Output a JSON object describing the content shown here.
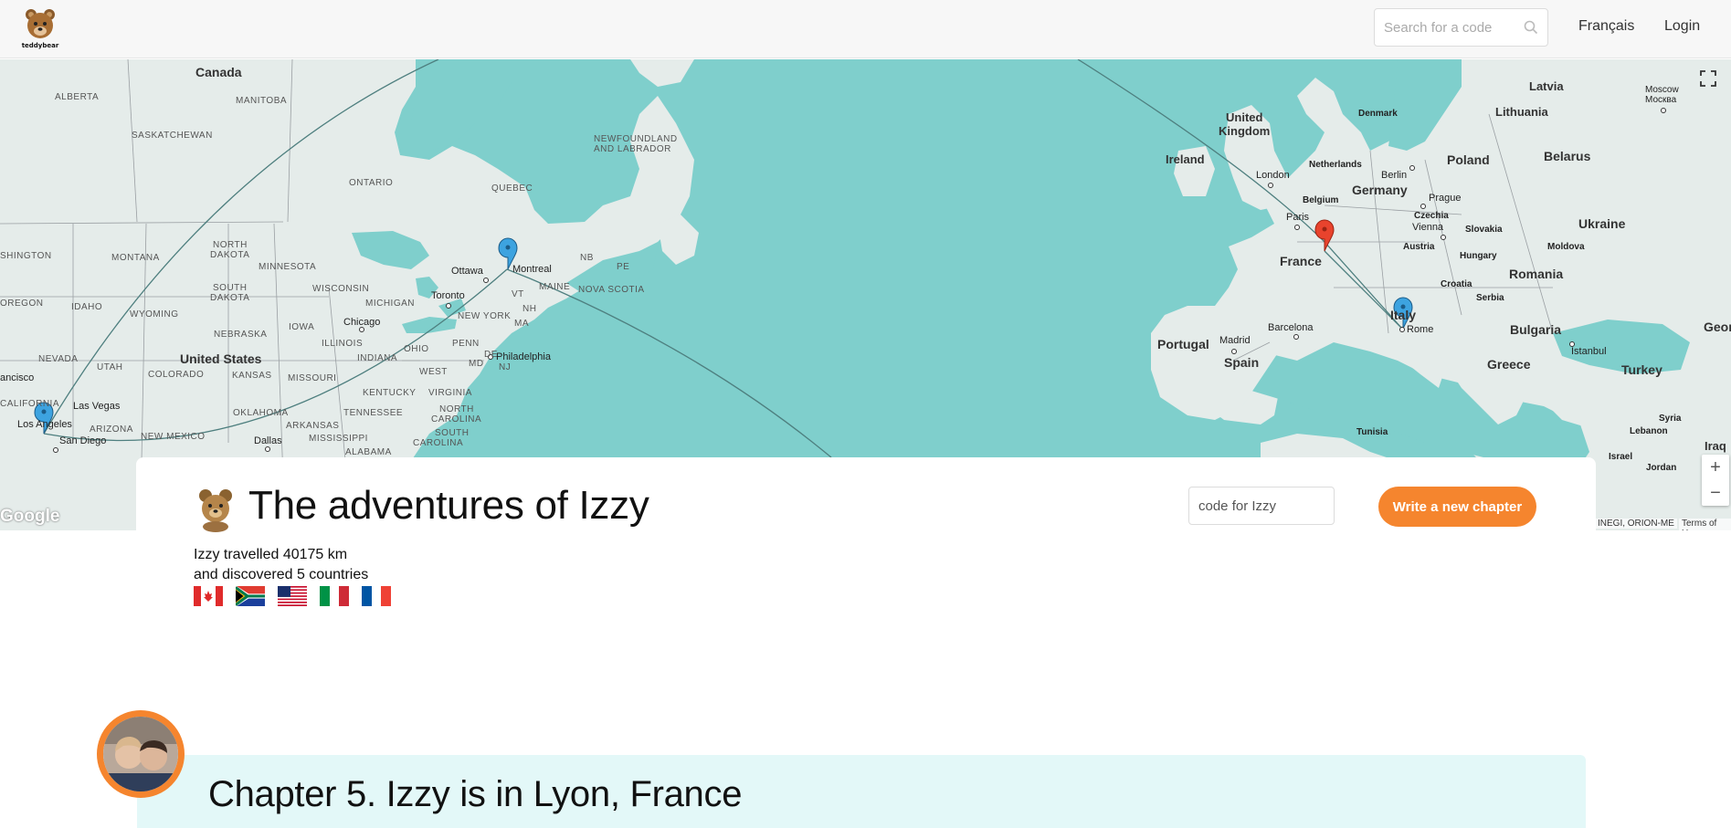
{
  "header": {
    "logo_text": "teddybear",
    "search_placeholder": "Search for a code",
    "language_link": "Français",
    "login_link": "Login"
  },
  "map": {
    "labels": {
      "canada": "Canada",
      "alberta": "ALBERTA",
      "manitoba": "MANITOBA",
      "saskatchewan": "SASKATCHEWAN",
      "ontario": "ONTARIO",
      "quebec": "QUEBEC",
      "newfoundland1": "NEWFOUNDLAND",
      "newfoundland2": "AND LABRADOR",
      "washington": "SHINGTON",
      "montana": "MONTANA",
      "north_dakota1": "NORTH",
      "north_dakota2": "DAKOTA",
      "minnesota": "MINNESOTA",
      "south_dakota1": "SOUTH",
      "south_dakota2": "DAKOTA",
      "wisconsin": "WISCONSIN",
      "michigan": "MICHIGAN",
      "oregon": "OREGON",
      "idaho": "IDAHO",
      "wyoming": "WYOMING",
      "nebraska": "NEBRASKA",
      "iowa": "IOWA",
      "illinois": "ILLINOIS",
      "ohio": "OHIO",
      "penn": "PENN",
      "new_york": "NEW YORK",
      "nevada": "NEVADA",
      "utah": "UTAH",
      "colorado": "COLORADO",
      "united_states": "United States",
      "kansas": "KANSAS",
      "missouri": "MISSOURI",
      "indiana": "INDIANA",
      "kentucky": "KENTUCKY",
      "virginia": "VIRGINIA",
      "west": "WEST",
      "california": "CALIFORNIA",
      "arizona": "ARIZONA",
      "new_mexico": "NEW MEXICO",
      "oklahoma": "OKLAHOMA",
      "arkansas": "ARKANSAS",
      "tennessee": "TENNESSEE",
      "north_carolina1": "NORTH",
      "north_carolina2": "CAROLINA",
      "south_carolina1": "SOUTH",
      "south_carolina2": "CAROLINA",
      "mississippi": "MISSISSIPPI",
      "alabama": "ALABAMA",
      "maine": "MAINE",
      "nova_scotia": "NOVA SCOTIA",
      "nb": "NB",
      "pe": "PE",
      "vt": "VT",
      "nh": "NH",
      "ma": "MA",
      "md": "MD",
      "de": "DE",
      "nj": "NJ",
      "ottawa": "Ottawa",
      "montreal": "Montreal",
      "toronto": "Toronto",
      "chicago": "Chicago",
      "philadelphia": "Philadelphia",
      "las_vegas": "Las Vegas",
      "los_angeles": "Los Angeles",
      "san_diego": "San Diego",
      "francisco": "ancisco",
      "dallas": "Dallas",
      "united_kingdom1": "United",
      "united_kingdom2": "Kingdom",
      "ireland": "Ireland",
      "london": "London",
      "netherlands": "Netherlands",
      "belgium": "Belgium",
      "germany": "Germany",
      "berlin": "Berlin",
      "poland": "Poland",
      "denmark": "Denmark",
      "latvia": "Latvia",
      "lithuania": "Lithuania",
      "belarus": "Belarus",
      "moscow1": "Moscow",
      "moscow2": "Москва",
      "ukraine": "Ukraine",
      "paris": "Paris",
      "prague": "Prague",
      "czechia": "Czechia",
      "vienna": "Vienna",
      "slovakia": "Slovakia",
      "austria": "Austria",
      "hungary": "Hungary",
      "moldova": "Moldova",
      "france": "France",
      "croatia": "Croatia",
      "romania": "Romania",
      "serbia": "Serbia",
      "italy": "Italy",
      "bulgaria": "Bulgaria",
      "rome": "Rome",
      "barcelona": "Barcelona",
      "madrid": "Madrid",
      "portugal": "Portugal",
      "spain": "Spain",
      "istanbul": "Istanbul",
      "greece": "Greece",
      "turkey": "Turkey",
      "georgia": "Geor",
      "syria": "Syria",
      "lebanon": "Lebanon",
      "iraq": "Iraq",
      "israel": "Israel",
      "jordan": "Jordan",
      "tunisia": "Tunisia"
    },
    "google_text": "Google",
    "attribution": "INEGI, ORION-ME",
    "terms": "Terms of Us",
    "zoom_in": "+",
    "zoom_out": "−"
  },
  "story": {
    "title": "The adventures of Izzy",
    "stats_line1": "Izzy travelled 40175 km",
    "stats_line2": "and discovered 5 countries",
    "flags": [
      "canada-flag",
      "south-africa-flag",
      "usa-flag",
      "italy-flag",
      "france-flag"
    ],
    "code_placeholder": "code for Izzy",
    "write_button": "Write a new chapter"
  },
  "chapter": {
    "title": "Chapter 5. Izzy is in Lyon, France"
  },
  "colors": {
    "accent": "#f5852e",
    "water": "#7fcfcc",
    "land": "#e5ecea",
    "chapter_bg": "#e3f8f8"
  }
}
